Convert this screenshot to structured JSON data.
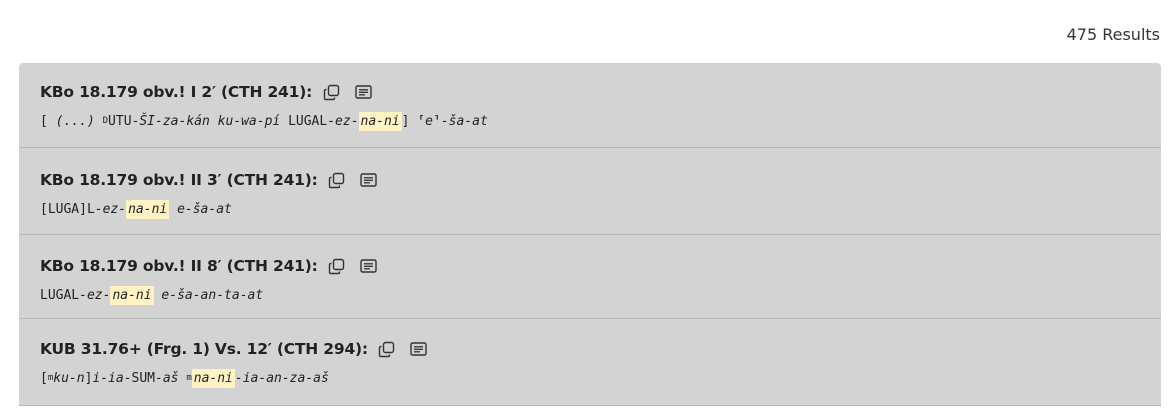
{
  "results_label": "475 Results",
  "results": [
    {
      "title": "KBo 18.179 obv.! I 2′ (CTH 241):",
      "segments": [
        {
          "text": "[ ",
          "style": "plain"
        },
        {
          "text": "(...)",
          "style": "italic"
        },
        {
          "text": " ",
          "style": "plain"
        },
        {
          "text": "D",
          "style": "sup"
        },
        {
          "text": "UTU-",
          "style": "plain"
        },
        {
          "text": "ŠI-za-kán ku-wa-pí ",
          "style": "italic"
        },
        {
          "text": "LUGAL",
          "style": "plain"
        },
        {
          "text": "-ez-",
          "style": "italic"
        },
        {
          "text": "na-ni",
          "style": "highlight"
        },
        {
          "text": "] ",
          "style": "plain"
        },
        {
          "text": "⸢",
          "style": "plain"
        },
        {
          "text": "e",
          "style": "italic"
        },
        {
          "text": "⸣",
          "style": "plain"
        },
        {
          "text": "-ša-at",
          "style": "italic"
        }
      ]
    },
    {
      "title": "KBo 18.179 obv.! II 3′ (CTH 241):",
      "segments": [
        {
          "text": "[LUGA]L",
          "style": "plain"
        },
        {
          "text": "-ez-",
          "style": "italic"
        },
        {
          "text": "na-ni",
          "style": "highlight"
        },
        {
          "text": " ",
          "style": "plain"
        },
        {
          "text": "e-ša-at",
          "style": "italic"
        }
      ]
    },
    {
      "title": "KBo 18.179 obv.! II 8′ (CTH 241):",
      "segments": [
        {
          "text": "LUGAL",
          "style": "plain"
        },
        {
          "text": "-ez-",
          "style": "italic"
        },
        {
          "text": "na-ni",
          "style": "highlight"
        },
        {
          "text": " ",
          "style": "plain"
        },
        {
          "text": "e-ša-an-ta-at",
          "style": "italic"
        }
      ]
    },
    {
      "title": "KUB 31.76+ (Frg. 1) Vs. 12′ (CTH 294):",
      "segments": [
        {
          "text": "[",
          "style": "plain"
        },
        {
          "text": "m",
          "style": "sup"
        },
        {
          "text": "ku-n",
          "style": "italic"
        },
        {
          "text": "]",
          "style": "plain"
        },
        {
          "text": "i-ia-",
          "style": "italic"
        },
        {
          "text": "SUM",
          "style": "plain"
        },
        {
          "text": "-aš ",
          "style": "italic"
        },
        {
          "text": "m",
          "style": "sup"
        },
        {
          "text": "na-ni",
          "style": "highlight"
        },
        {
          "text": "-ia-an-za-aš",
          "style": "italic"
        }
      ]
    }
  ],
  "icons": {
    "copy": "copy-icon",
    "document": "document-icon"
  }
}
